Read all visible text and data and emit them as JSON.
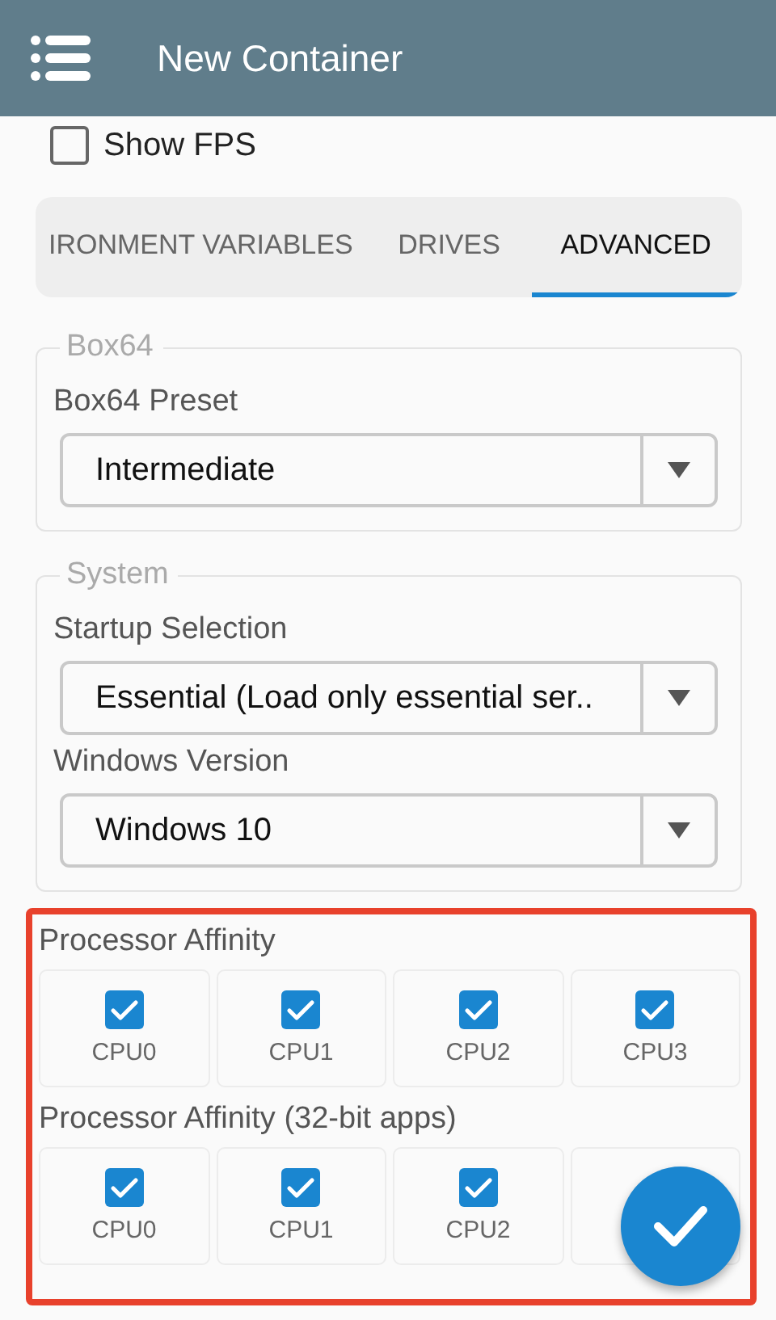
{
  "app_bar": {
    "title": "New Container"
  },
  "show_fps": {
    "label": "Show FPS",
    "checked": false
  },
  "tabs": [
    {
      "label": "IRONMENT VARIABLES",
      "selected": false
    },
    {
      "label": "DRIVES",
      "selected": false
    },
    {
      "label": "ADVANCED",
      "selected": true
    }
  ],
  "groups": [
    {
      "title": "Box64",
      "fields": [
        {
          "label": "Box64 Preset",
          "value": "Intermediate"
        }
      ]
    },
    {
      "title": "System",
      "fields": [
        {
          "label": "Startup Selection",
          "value": "Essential (Load only essential ser.."
        },
        {
          "label": "Windows Version",
          "value": "Windows 10"
        }
      ]
    }
  ],
  "affinity_sections": [
    {
      "title": "Processor Affinity",
      "cpus": [
        {
          "label": "CPU0",
          "checked": true
        },
        {
          "label": "CPU1",
          "checked": true
        },
        {
          "label": "CPU2",
          "checked": true
        },
        {
          "label": "CPU3",
          "checked": true
        }
      ]
    },
    {
      "title": "Processor Affinity (32-bit apps)",
      "cpus": [
        {
          "label": "CPU0",
          "checked": true
        },
        {
          "label": "CPU1",
          "checked": true
        },
        {
          "label": "CPU2",
          "checked": true
        }
      ]
    }
  ]
}
